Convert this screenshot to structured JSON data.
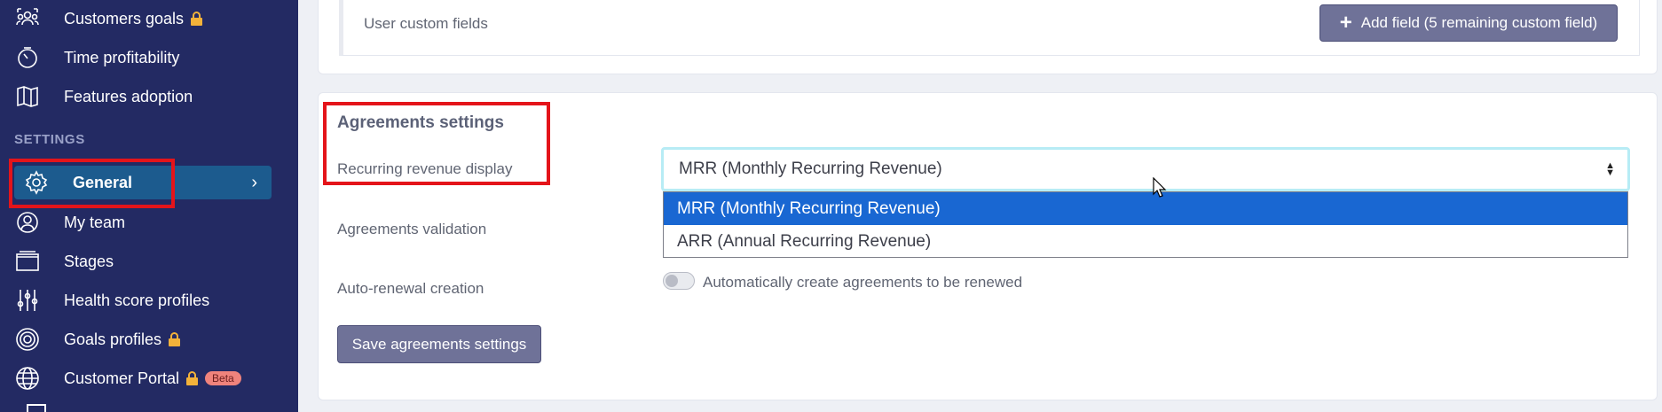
{
  "sidebar": {
    "items_top": [
      {
        "label": "Customers goals",
        "icon": "users-group-icon",
        "locked": true
      },
      {
        "label": "Time profitability",
        "icon": "clock-icon",
        "locked": false
      },
      {
        "label": "Features adoption",
        "icon": "map-icon",
        "locked": false
      }
    ],
    "section": "SETTINGS",
    "active": {
      "label": "General",
      "icon": "gear-icon",
      "chevron": "›"
    },
    "items_bottom": [
      {
        "label": "My team",
        "icon": "user-icon"
      },
      {
        "label": "Stages",
        "icon": "stages-icon"
      },
      {
        "label": "Health score profiles",
        "icon": "sliders-icon"
      },
      {
        "label": "Goals profiles",
        "icon": "target-icon",
        "locked": true
      },
      {
        "label": "Customer Portal",
        "icon": "globe-icon",
        "locked": true,
        "badge": "Beta"
      }
    ]
  },
  "custom_fields": {
    "label": "User custom fields",
    "add_button": "Add field (5 remaining custom field)",
    "add_icon": "+"
  },
  "agreements": {
    "title": "Agreements settings",
    "recurring_label": "Recurring revenue display",
    "select_value": "MRR (Monthly Recurring Revenue)",
    "options": [
      "MRR (Monthly Recurring Revenue)",
      "ARR (Annual Recurring Revenue)"
    ],
    "validation_label": "Agreements validation",
    "renewal_label": "Auto-renewal creation",
    "renewal_toggle_text": "Automatically create agreements to be renewed",
    "save_button": "Save agreements settings"
  },
  "colors": {
    "sidebar_bg": "#232a63",
    "active_item": "#1c5b8e",
    "highlight": "#e4141a",
    "primary_button": "#6f7298",
    "selected_option": "#1967d2"
  }
}
